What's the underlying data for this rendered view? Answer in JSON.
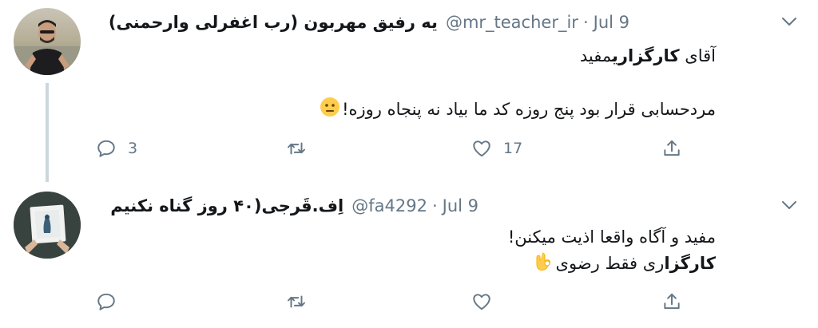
{
  "tweets": [
    {
      "display_name": "یه رفیق مهربون (رب اغفرلی وارحمنی)",
      "handle": "@mr_teacher_ir",
      "separator": "·",
      "time": "Jul 9",
      "line1_prefix": "آقای ",
      "line1_bold": "کارگزاری",
      "line1_suffix": "مفید",
      "line2": "مردحسابی قرار بود پنج روزه کد ما بیاد نه پنجاه روزه!",
      "line2_emoji": "neutral-face-emoji",
      "reply_count": "3",
      "retweet_count": "",
      "like_count": "17"
    },
    {
      "display_name": "اِف.قَرجی(۴۰ روز گناه نکنیم",
      "handle": "@fa4292",
      "separator": "·",
      "time": "Jul 9",
      "line1": "مفید و آگاه واقعا اذیت میکنن!",
      "line2_bold": "کارگزا",
      "line2_rest": "ری فقط رضوی",
      "line2_emoji": "ok-hand-emoji",
      "reply_count": "",
      "retweet_count": "",
      "like_count": ""
    }
  ],
  "icons": {
    "reply": "reply-icon",
    "retweet": "retweet-icon",
    "like": "like-icon",
    "share": "share-icon",
    "caret": "chevron-down-icon"
  },
  "colors": {
    "text": "#14171a",
    "secondary": "#657786",
    "thread_line": "#ccd6dd",
    "emoji_yellow": "#ffcc4d"
  }
}
